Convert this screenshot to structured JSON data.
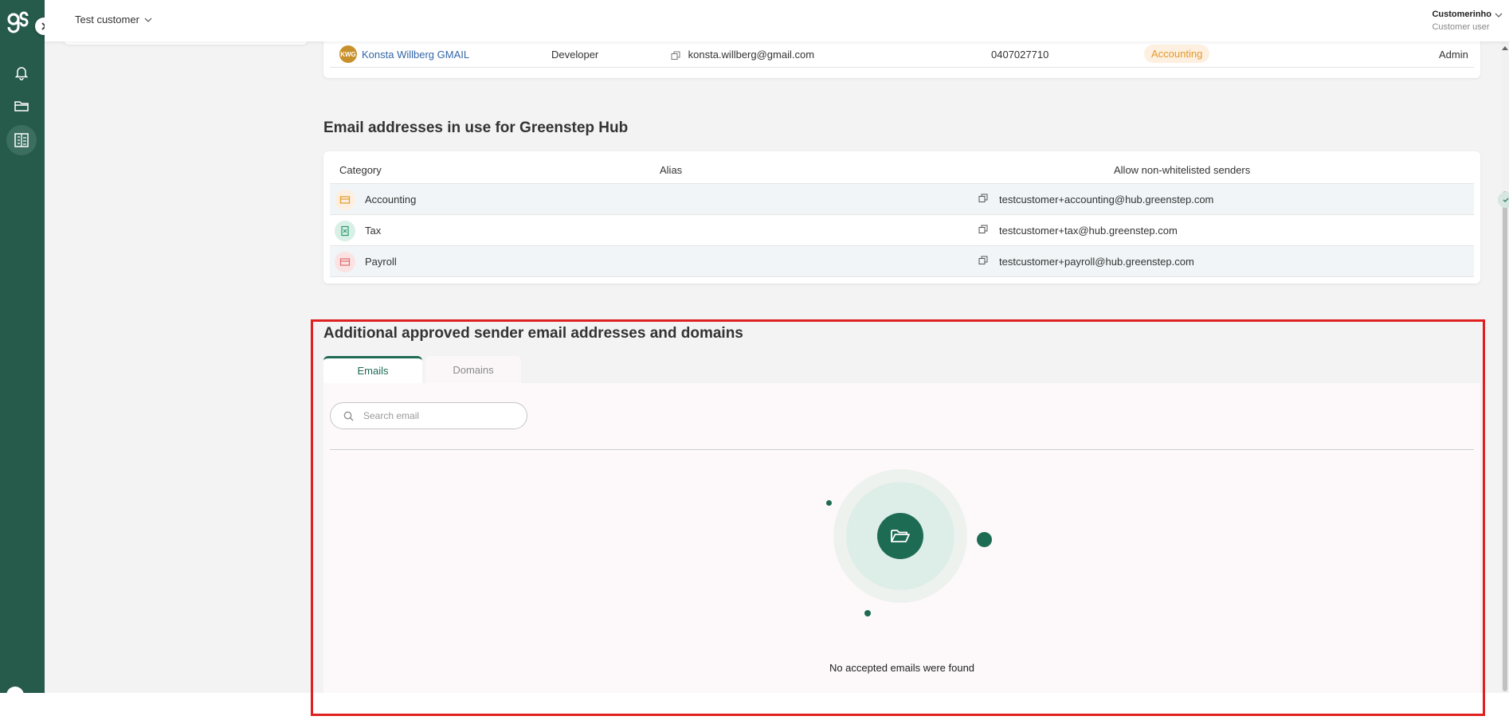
{
  "header": {
    "customer_select": "Test customer",
    "user_name": "Customerinho",
    "user_role": "Customer user"
  },
  "users_table": {
    "row": {
      "initials": "KWG",
      "name": "Konsta Willberg GMAIL",
      "title": "Developer",
      "email": "konsta.willberg@gmail.com",
      "phone": "0407027710",
      "category": "Accounting",
      "role": "Admin"
    }
  },
  "email_section": {
    "title": "Email addresses in use for Greenstep Hub",
    "headers": {
      "category": "Category",
      "alias": "Alias",
      "allow": "Allow non-whitelisted senders"
    },
    "rows": [
      {
        "category": "Accounting",
        "alias": "testcustomer+accounting@hub.greenstep.com",
        "allow_non_whitelisted": true,
        "icon": "accounting-icon"
      },
      {
        "category": "Tax",
        "alias": "testcustomer+tax@hub.greenstep.com",
        "allow_non_whitelisted": false,
        "icon": "tax-icon"
      },
      {
        "category": "Payroll",
        "alias": "testcustomer+payroll@hub.greenstep.com",
        "allow_non_whitelisted": false,
        "icon": "payroll-icon"
      }
    ]
  },
  "approved_section": {
    "title": "Additional approved sender email addresses and domains",
    "tabs": [
      "Emails",
      "Domains"
    ],
    "active_tab": "Emails",
    "search_placeholder": "Search email",
    "search_value": "",
    "empty_message": "No accepted emails were found"
  },
  "colors": {
    "sidebar": "#265a4a",
    "brand": "#1e6b54",
    "highlight": "#e02020",
    "accounting_badge": "#e2982c"
  }
}
